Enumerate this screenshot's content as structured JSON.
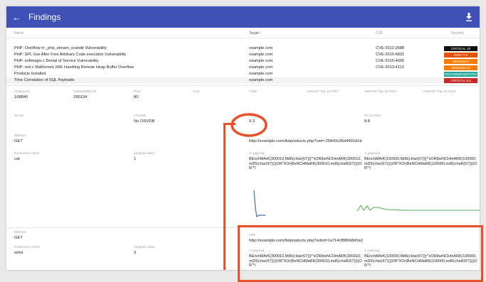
{
  "appbar": {
    "title": "Findings",
    "back_icon": "arrow-left-icon",
    "download_icon": "download-icon",
    "color": "#3f51b5"
  },
  "table": {
    "headers": {
      "name": "Name",
      "target": "Target ↑",
      "cve": "CVE",
      "severity": "Severity"
    },
    "rows": [
      {
        "name": "PHP: Overflow in _php_stream_scandir Vulnerability",
        "target": "example.com",
        "cve": "CVE-2012-2688",
        "severity": "CRITICAL 10",
        "sev_color": "#111111"
      },
      {
        "name": "PHP: SPL Use After Free Arbitrary Code execution Vulnerability",
        "target": "example.com",
        "cve": "CVE-2015-6831",
        "severity": "HIGH 7.5",
        "sev_color": "#e65100"
      },
      {
        "name": "PHP: softmagic.c Denial of Service Vulnerability",
        "target": "example.com",
        "cve": "CVE-2015-4605",
        "severity": "MEDIUM 5",
        "sev_color": "#f57c00"
      },
      {
        "name": "PHP: xml.c Malformed XML Handling Remote Heap Buffer Overflow",
        "target": "example.com",
        "cve": "CVE-2013-4113",
        "severity": "MEDIUM 6.8",
        "sev_color": "#f57c00"
      },
      {
        "name": "Products Installed",
        "target": "example.com",
        "cve": "",
        "severity": "RECOMMENDATION",
        "sev_color": "#26a69a"
      },
      {
        "name": "Time Correlation of SQL Payloads",
        "target": "example.com",
        "cve": "",
        "severity": "CRITICAL 9.3",
        "sev_color": "#c62828"
      }
    ]
  },
  "detail": {
    "finding_id_label": "Finding ID",
    "finding_id": "168840",
    "vuln_id_label": "Vulnerability ID",
    "vuln_id": "296234",
    "port_label": "Port",
    "port": "80",
    "cve_label": "CVE",
    "cwe_label": "CWE",
    "owasp2007_label": "OWASP Top 10 2007",
    "owasp2010_label": "OWASP Top 10 2010",
    "owasp2013_label": "OWASP Top 10 2013",
    "wasc_label": "WASC",
    "osvdb_label": "OSVDB",
    "osvdb": "No OSVDB",
    "cvss_label": "CVSS",
    "cvss": "9.3",
    "pci_cvss_label": "PCI CVSS",
    "pci_cvss": "8.8"
  },
  "request1": {
    "method_label": "Method",
    "method": "GET",
    "param_label": "Parameter name",
    "param": "cat",
    "orig_label": "Original value",
    "orig": "1",
    "url_label": "URL",
    "url": "http://example.com/listproducts.php?cat=-25843c95d4491d1b",
    "x_label": "X payload",
    "x_payload": "BEnchMArK(300010,Md5(cHar(67)))*'xOR(beNCHmARK(300010,mD5(char(67))))OR\"XOr(BeNCHMaRK(300010,md5(chaR(67))))OR\"*/",
    "y_label": "Y payload",
    "y_payload": "BEnchMArK(100000,Md5(cHar(67)))*'xOR(beNCHmARK(100000,mD5(char(67))))OR\"XOr(BeNCHMaRK(100000,md5(chaR(67))))OR\"*/"
  },
  "request2": {
    "method_label": "Method",
    "method": "GET",
    "param_label": "Parameter name",
    "param": "artist",
    "orig_label": "Original value",
    "orig": "3",
    "url_label": "URL",
    "url": "http://example.com/listproducts.php?artist=1a714cf886b8d0a2",
    "x_label": "X payload",
    "x_payload": "BEnchMArK(300010,Md5(cHar(67)))*'xOR(beNCHmARK(300010,mD5(char(67))))OR\"XOr(BeNCHMaRK(300010,md5(chaR(67))))OR\"*/",
    "y_label": "Y payload",
    "y_payload": "BEnchMArK(100000,Md5(cHar(67)))*'xOR(beNCHmARK(100000,mD5(char(67))))OR\"XOr(BeNCHMaRK(100000,md5(chaR(67))))OR\"*/"
  },
  "annotation_color": "#e8512a"
}
